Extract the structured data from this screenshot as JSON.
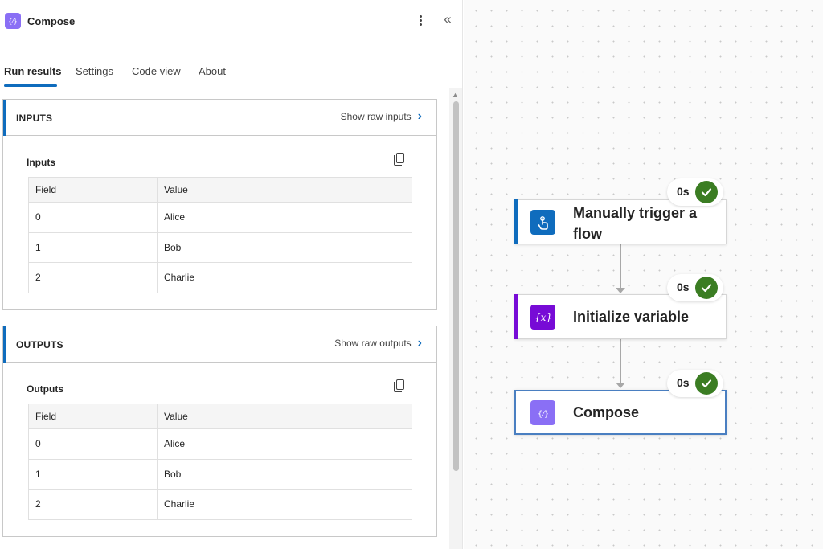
{
  "panel": {
    "title": "Compose",
    "tabs": [
      {
        "label": "Run results",
        "active": true
      },
      {
        "label": "Settings",
        "active": false
      },
      {
        "label": "Code view",
        "active": false
      },
      {
        "label": "About",
        "active": false
      }
    ],
    "inputs": {
      "section_title": "INPUTS",
      "raw_link": "Show raw inputs",
      "subsection_label": "Inputs",
      "columns": [
        "Field",
        "Value"
      ],
      "rows": [
        [
          "0",
          "Alice"
        ],
        [
          "1",
          "Bob"
        ],
        [
          "2",
          "Charlie"
        ]
      ]
    },
    "outputs": {
      "section_title": "OUTPUTS",
      "raw_link": "Show raw outputs",
      "subsection_label": "Outputs",
      "columns": [
        "Field",
        "Value"
      ],
      "rows": [
        [
          "0",
          "Alice"
        ],
        [
          "1",
          "Bob"
        ],
        [
          "2",
          "Charlie"
        ]
      ]
    }
  },
  "canvas": {
    "nodes": [
      {
        "label": "Manually trigger a flow",
        "duration": "0s",
        "status": "succeeded",
        "icon": "touch-icon",
        "color": "#0f6cbd"
      },
      {
        "label": "Initialize variable",
        "duration": "0s",
        "status": "succeeded",
        "icon": "variable-icon",
        "color": "#770bd6"
      },
      {
        "label": "Compose",
        "duration": "0s",
        "status": "succeeded",
        "icon": "compose-icon",
        "color": "#8a6ff5"
      }
    ]
  },
  "colors": {
    "accent": "#0f6cbd",
    "success": "#3b7d23",
    "variable": "#770bd6",
    "compose": "#8a6ff5"
  }
}
